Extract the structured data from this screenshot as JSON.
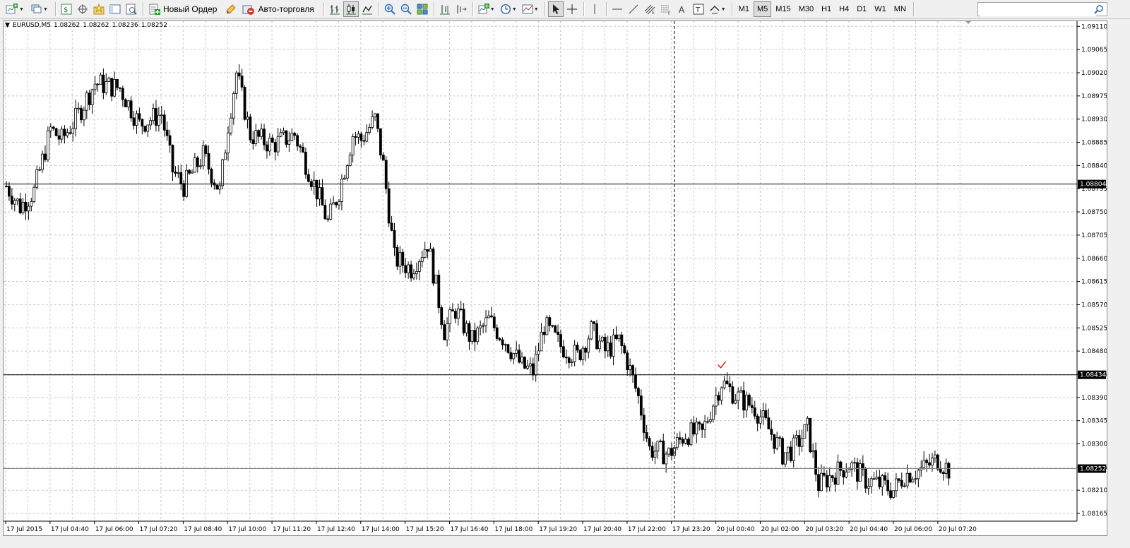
{
  "toolbar": {
    "new_order_label": "Новый Ордер",
    "autotrading_label": "Авто-торговля",
    "timeframes": [
      "M1",
      "M5",
      "M15",
      "M30",
      "H1",
      "H4",
      "D1",
      "W1",
      "MN"
    ],
    "active_timeframe": "M5",
    "search_placeholder": ""
  },
  "chart": {
    "symbol": "EURUSD,M5",
    "open": "1.08262",
    "high": "1.08262",
    "low": "1.08236",
    "close": "1.08252",
    "current_price": 1.08252,
    "horizontal_lines": [
      1.08804,
      1.08434
    ],
    "vertical_line_time": "17 Jul 23:25",
    "trade_marker_price": 1.08434,
    "price_ticks": [
      "1.09110",
      "1.09065",
      "1.09020",
      "1.08975",
      "1.08930",
      "1.08885",
      "1.08840",
      "1.08795",
      "1.08750",
      "1.08705",
      "1.08660",
      "1.08615",
      "1.08570",
      "1.08525",
      "1.08480",
      "1.08435",
      "1.08390",
      "1.08345",
      "1.08300",
      "1.08255",
      "1.08210",
      "1.08165"
    ],
    "time_ticks": [
      "17 Jul 2015",
      "17 Jul 04:40",
      "17 Jul 06:00",
      "17 Jul 07:20",
      "17 Jul 08:40",
      "17 Jul 10:00",
      "17 Jul 11:20",
      "17 Jul 12:40",
      "17 Jul 14:00",
      "17 Jul 15:20",
      "17 Jul 16:40",
      "17 Jul 18:00",
      "17 Jul 19:20",
      "17 Jul 20:40",
      "17 Jul 22:00",
      "17 Jul 23:20",
      "20 Jul 00:40",
      "20 Jul 02:00",
      "20 Jul 03:20",
      "20 Jul 04:40",
      "20 Jul 06:00",
      "20 Jul 07:20"
    ],
    "price_labels": [
      "1.08804",
      "1.08434",
      "1.08252"
    ]
  },
  "chart_data": {
    "type": "candlestick",
    "symbol": "EURUSD",
    "timeframe": "M5",
    "ylim": [
      1.0815,
      1.0912
    ],
    "grid": true,
    "anchors": [
      {
        "time": "17 Jul 03:20",
        "close": 1.088
      },
      {
        "time": "17 Jul 03:45",
        "close": 1.0876
      },
      {
        "time": "17 Jul 04:10",
        "close": 1.0879
      },
      {
        "time": "17 Jul 04:40",
        "close": 1.0891
      },
      {
        "time": "17 Jul 05:00",
        "close": 1.0889
      },
      {
        "time": "17 Jul 05:25",
        "close": 1.0893
      },
      {
        "time": "17 Jul 06:00",
        "close": 1.09
      },
      {
        "time": "17 Jul 06:45",
        "close": 1.0899
      },
      {
        "time": "17 Jul 07:20",
        "close": 1.0892
      },
      {
        "time": "17 Jul 08:00",
        "close": 1.0894
      },
      {
        "time": "17 Jul 08:20",
        "close": 1.0883
      },
      {
        "time": "17 Jul 08:40",
        "close": 1.088
      },
      {
        "time": "17 Jul 09:15",
        "close": 1.0886
      },
      {
        "time": "17 Jul 09:45",
        "close": 1.0879
      },
      {
        "time": "17 Jul 10:00",
        "close": 1.0892
      },
      {
        "time": "17 Jul 10:15",
        "close": 1.0902
      },
      {
        "time": "17 Jul 10:40",
        "close": 1.089
      },
      {
        "time": "17 Jul 11:20",
        "close": 1.0888
      },
      {
        "time": "17 Jul 12:00",
        "close": 1.089
      },
      {
        "time": "17 Jul 12:40",
        "close": 1.0879
      },
      {
        "time": "17 Jul 13:00",
        "close": 1.0873
      },
      {
        "time": "17 Jul 13:20",
        "close": 1.0879
      },
      {
        "time": "17 Jul 13:45",
        "close": 1.089
      },
      {
        "time": "17 Jul 14:00",
        "close": 1.0889
      },
      {
        "time": "17 Jul 14:25",
        "close": 1.0893
      },
      {
        "time": "17 Jul 14:40",
        "close": 1.0884
      },
      {
        "time": "17 Jul 15:00",
        "close": 1.0866
      },
      {
        "time": "17 Jul 15:30",
        "close": 1.0864
      },
      {
        "time": "17 Jul 16:00",
        "close": 1.0869
      },
      {
        "time": "17 Jul 16:30",
        "close": 1.0852
      },
      {
        "time": "17 Jul 16:50",
        "close": 1.0856
      },
      {
        "time": "17 Jul 17:20",
        "close": 1.085
      },
      {
        "time": "17 Jul 17:50",
        "close": 1.0854
      },
      {
        "time": "17 Jul 18:20",
        "close": 1.085
      },
      {
        "time": "17 Jul 18:50",
        "close": 1.0845
      },
      {
        "time": "17 Jul 19:10",
        "close": 1.0844
      },
      {
        "time": "17 Jul 19:30",
        "close": 1.0853
      },
      {
        "time": "17 Jul 20:00",
        "close": 1.0849
      },
      {
        "time": "17 Jul 20:30",
        "close": 1.0847
      },
      {
        "time": "17 Jul 20:55",
        "close": 1.0852
      },
      {
        "time": "17 Jul 21:20",
        "close": 1.0848
      },
      {
        "time": "17 Jul 21:45",
        "close": 1.085
      },
      {
        "time": "17 Jul 22:00",
        "close": 1.0846
      },
      {
        "time": "17 Jul 22:20",
        "close": 1.0839
      },
      {
        "time": "17 Jul 22:40",
        "close": 1.0829
      },
      {
        "time": "17 Jul 23:15",
        "close": 1.0828
      },
      {
        "time": "17 Jul 23:45",
        "close": 1.0832
      },
      {
        "time": "20 Jul 00:15",
        "close": 1.0832
      },
      {
        "time": "20 Jul 00:35",
        "close": 1.0838
      },
      {
        "time": "20 Jul 00:50",
        "close": 1.0842
      },
      {
        "time": "20 Jul 01:20",
        "close": 1.0839
      },
      {
        "time": "20 Jul 01:50",
        "close": 1.0837
      },
      {
        "time": "20 Jul 02:20",
        "close": 1.0832
      },
      {
        "time": "20 Jul 02:40",
        "close": 1.0828
      },
      {
        "time": "20 Jul 03:00",
        "close": 1.0829
      },
      {
        "time": "20 Jul 03:25",
        "close": 1.0833
      },
      {
        "time": "20 Jul 03:45",
        "close": 1.0822
      },
      {
        "time": "20 Jul 04:10",
        "close": 1.0824
      },
      {
        "time": "20 Jul 04:40",
        "close": 1.0826
      },
      {
        "time": "20 Jul 05:10",
        "close": 1.0823
      },
      {
        "time": "20 Jul 05:40",
        "close": 1.0822
      },
      {
        "time": "20 Jul 06:00",
        "close": 1.0821
      },
      {
        "time": "20 Jul 06:20",
        "close": 1.0824
      },
      {
        "time": "20 Jul 06:50",
        "close": 1.0825
      },
      {
        "time": "20 Jul 07:20",
        "close": 1.0827
      },
      {
        "time": "20 Jul 07:40",
        "close": 1.0825
      }
    ]
  }
}
